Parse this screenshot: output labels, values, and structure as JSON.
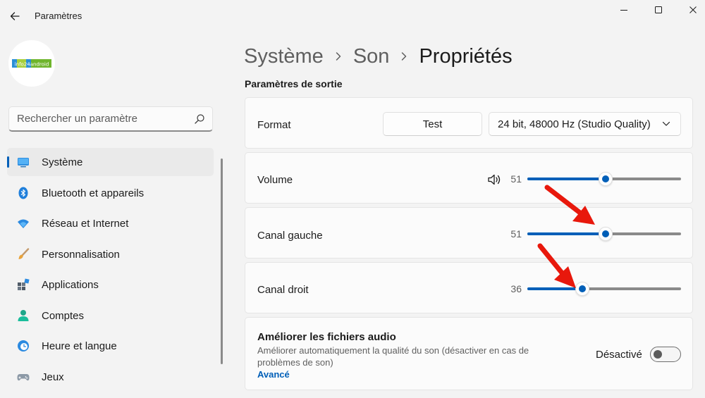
{
  "window": {
    "title": "Paramètres"
  },
  "avatar": {
    "logo_text": "info24android"
  },
  "search": {
    "placeholder": "Rechercher un paramètre"
  },
  "sidebar": {
    "items": [
      {
        "label": "Système",
        "icon": "monitor-icon",
        "active": true
      },
      {
        "label": "Bluetooth et appareils",
        "icon": "bluetooth-icon"
      },
      {
        "label": "Réseau et Internet",
        "icon": "wifi-icon"
      },
      {
        "label": "Personnalisation",
        "icon": "brush-icon"
      },
      {
        "label": "Applications",
        "icon": "apps-icon"
      },
      {
        "label": "Comptes",
        "icon": "person-icon"
      },
      {
        "label": "Heure et langue",
        "icon": "clock-globe-icon"
      },
      {
        "label": "Jeux",
        "icon": "gamepad-icon"
      }
    ]
  },
  "breadcrumb": {
    "items": [
      "Système",
      "Son",
      "Propriétés"
    ]
  },
  "section": {
    "title": "Paramètres de sortie"
  },
  "format": {
    "label": "Format",
    "test_label": "Test",
    "selected": "24 bit, 48000 Hz (Studio Quality)"
  },
  "sliders": [
    {
      "label": "Volume",
      "value": 51,
      "max": 100,
      "icon": "speaker-icon"
    },
    {
      "label": "Canal gauche",
      "value": 51,
      "max": 100
    },
    {
      "label": "Canal droit",
      "value": 36,
      "max": 100
    }
  ],
  "enhance": {
    "title": "Améliorer les fichiers audio",
    "description": "Améliorer automatiquement la qualité du son (désactiver en cas de problèmes de son)",
    "link": "Avancé",
    "state_label": "Désactivé",
    "enabled": false
  },
  "colors": {
    "accent": "#005fb8",
    "annotation_arrow": "#e8180c"
  }
}
